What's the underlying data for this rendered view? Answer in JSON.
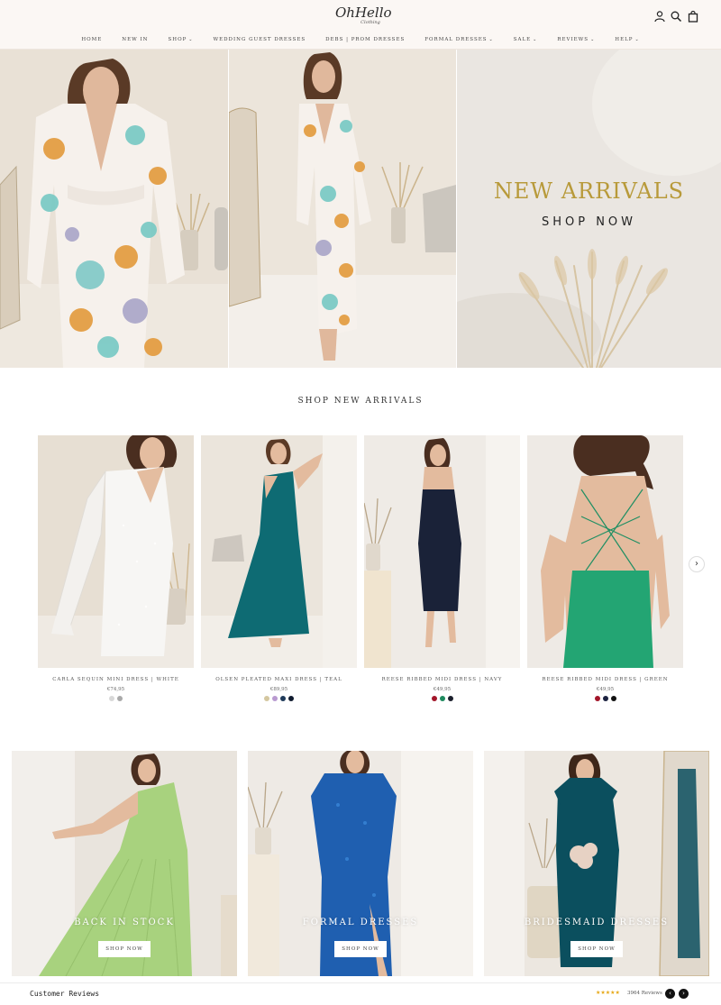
{
  "header": {
    "logo_main": "OhHello",
    "logo_sub": "Clothing",
    "nav": [
      {
        "label": "HOME",
        "has_dropdown": false
      },
      {
        "label": "NEW IN",
        "has_dropdown": false
      },
      {
        "label": "SHOP",
        "has_dropdown": true
      },
      {
        "label": "WEDDING GUEST DRESSES",
        "has_dropdown": false
      },
      {
        "label": "DEBS | PROM DRESSES",
        "has_dropdown": false
      },
      {
        "label": "FORMAL DRESSES",
        "has_dropdown": true
      },
      {
        "label": "SALE",
        "has_dropdown": true
      },
      {
        "label": "REVIEWS",
        "has_dropdown": true
      },
      {
        "label": "HELP",
        "has_dropdown": true
      }
    ],
    "icons": [
      "account-icon",
      "search-icon",
      "bag-icon"
    ]
  },
  "hero": {
    "title": "NEW ARRIVALS",
    "cta": "SHOP NOW",
    "title_color": "#b89a3a"
  },
  "new_arrivals": {
    "title": "SHOP NEW ARRIVALS",
    "products": [
      {
        "name": "CARLA SEQUIN MINI DRESS | WHITE",
        "price": "€74,95",
        "swatches": [
          "#d8d8d8",
          "#a9a9a9"
        ]
      },
      {
        "name": "OLSEN PLEATED MAXI DRESS | TEAL",
        "price": "€89,95",
        "swatches": [
          "#d4c7a0",
          "#b99ad0",
          "#1f3a5a",
          "#0f1a2e"
        ]
      },
      {
        "name": "REESE RIBBED MIDI DRESS | NAVY",
        "price": "€49,95",
        "swatches": [
          "#a3162a",
          "#1e8a5e",
          "#1b1f2c"
        ]
      },
      {
        "name": "REESE RIBBED MIDI DRESS | GREEN",
        "price": "€49,95",
        "swatches": [
          "#a3162a",
          "#1b2240",
          "#111111"
        ]
      }
    ]
  },
  "tiles": [
    {
      "title": "BACK IN STOCK",
      "button": "SHOP NOW"
    },
    {
      "title": "FORMAL DRESSES",
      "button": "SHOP NOW"
    },
    {
      "title": "BRIDESMAID DRESSES",
      "button": "SHOP NOW"
    }
  ],
  "reviews": {
    "label": "Customer Reviews",
    "stars": "★★★★★",
    "count": "3964 Reviews"
  },
  "colors": {
    "header_bg": "#fbf7f4",
    "accent_gold": "#b89a3a",
    "star_color": "#e6a817"
  }
}
